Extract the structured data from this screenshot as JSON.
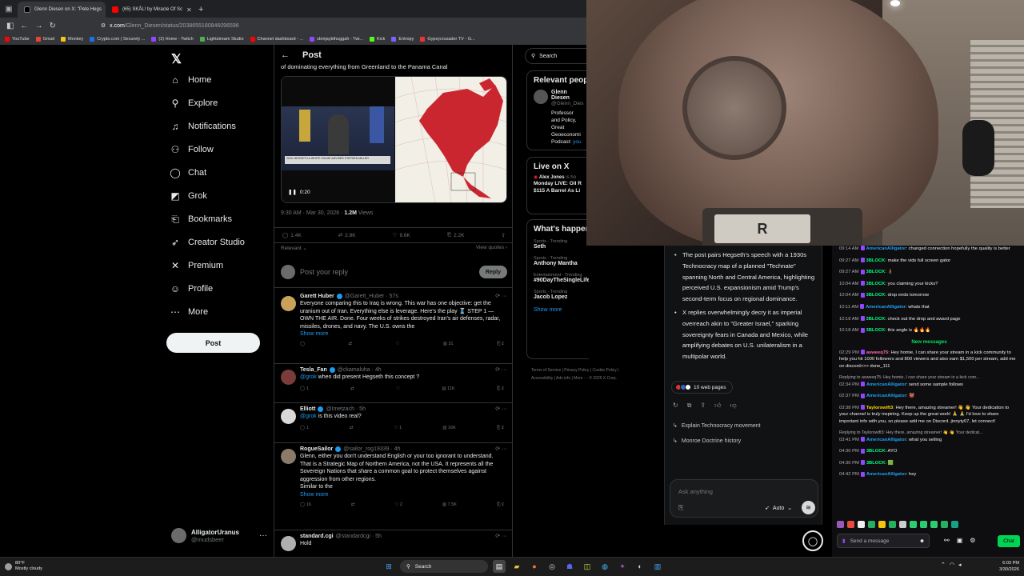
{
  "browser": {
    "tabs": [
      {
        "label": "Glenn Diesen on X: \"Pete Hegs",
        "active": true
      },
      {
        "label": "(65) SKÅL! by Miracle Of Sc",
        "active": false
      }
    ],
    "url_host": "x.com",
    "url_path": "/Glenn_Diesen/status/2038655180846096596",
    "bookmarks": [
      "YouTube",
      "Gmail",
      "Monkey",
      "Crypto.com | Securely ...",
      "(2) Home - Twitch",
      "Lightstream Studio",
      "Channel dashboard - ...",
      "sbmjaybthuggah - Twi...",
      "Kick",
      "Entropy",
      "Gypsycrusader TV - G..."
    ]
  },
  "xnav": {
    "items": [
      "Home",
      "Explore",
      "Notifications",
      "Follow",
      "Chat",
      "Grok",
      "Bookmarks",
      "Creator Studio",
      "Premium",
      "Profile",
      "More"
    ],
    "post_button": "Post",
    "account_name": "AlligatorUranus",
    "account_handle": "@mudsbeer"
  },
  "post": {
    "header": "Post",
    "text_tail": "of dominating everything from Greenland to the Panama Canal",
    "video_time": "0:20",
    "chyron": "2024: HEGSETH & WHITE HOUSE ADVISER STEPHEN MILLER",
    "timestamp": "9:30 AM · Mar 30, 2026 · ",
    "views": "1.2M",
    "views_label": "Views",
    "stats": {
      "replies": "1.4K",
      "reposts": "2.8K",
      "likes": "9.6K",
      "bookmarks": "2.2K"
    },
    "sort_label": "Relevant",
    "view_quotes": "View quotes",
    "reply_placeholder": "Post your reply",
    "reply_button": "Reply"
  },
  "replies": [
    {
      "name": "Garett Huber",
      "handle": "@Garett_Huber · 57s",
      "text": "Everyone comparing this to Iraq is wrong. This war has one objective: get the uranium out of Iran. Everything else is leverage. Here's the play 🧵 STEP 1 — OWN THE AIR. Done. Four weeks of strikes destroyed Iran's air defenses, radar, missiles, drones, and navy. The U.S. owns the",
      "more": "Show more",
      "stats": [
        "",
        "",
        "",
        "31",
        ""
      ]
    },
    {
      "name": "Tesla_Fan",
      "handle": "@ckamaluha · 4h",
      "mention": "@grok",
      "text": " when did present Hegseth this concept ?",
      "stats": [
        "1",
        "",
        "",
        "11K",
        ""
      ]
    },
    {
      "name": "Elliott",
      "handle": "@Imetzach · 5h",
      "mention": "@grok",
      "text": " is this video real?",
      "stats": [
        "1",
        "",
        "1",
        "16K",
        ""
      ]
    },
    {
      "name": "RogueSailor",
      "handle": "@sailor_rog19339 · 4h",
      "text": "Glenn, either you don't understand English or your too ignorant to understand.\nThat is a Strategic Map of Northern America, not the USA. It represents all the Sovereign Nations that share a common goal to protect themselves against aggression from other regions.\nSimilar to the",
      "more": "Show more",
      "stats": [
        "16",
        "",
        "2",
        "7.5K",
        ""
      ]
    },
    {
      "name": "standard.cgi",
      "handle": "@standardcgi · 5h",
      "text": "Hold"
    }
  ],
  "rcol": {
    "search_placeholder": "Search",
    "relevant_title": "Relevant people",
    "glenn_name": "Glenn Diesen",
    "glenn_handle": "@Glenn_Dies",
    "glenn_bio": "Professor and Policy, Great Geoeconomi Podcast: ",
    "glenn_link": "you",
    "live_title": "Live on X",
    "live_who": "Alex Jones",
    "live_status": "is ho",
    "live_text": "Monday LIVE: Oil R $115 A Barrel As Li",
    "happening_title": "What's happening",
    "trends": [
      {
        "cat": "Sports · Trending",
        "title": "Seth"
      },
      {
        "cat": "Sports · Trending",
        "title": "Anthony Mantha"
      },
      {
        "cat": "Entertainment · Trending",
        "title": "#90DayTheSingleLife"
      },
      {
        "cat": "Sports · Trending",
        "title": "Jacob Lopez"
      }
    ],
    "show_more": "Show more",
    "footer_1": "Terms of Service  |  Privacy Policy  |  Cookie Policy  |",
    "footer_2": "Accessibility  |  Ads info  |  More ···  © 2026 X Corp."
  },
  "grok": {
    "bullets": [
      "The post pairs Hegseth's speech with a 1930s Technocracy map of a planned \"Technate\" spanning North and Central America, highlighting perceived U.S. expansionism amid Trump's second-term focus on regional dominance.",
      "X replies overwhelmingly decry it as imperial overreach akin to \"Greater Israel,\" sparking sovereignty fears in Canada and Mexico, while amplifying debates on U.S. unilateralism in a multipolar world."
    ],
    "web_pages": "10 web pages",
    "suggestions": [
      "Explain Technocracy movement",
      "Monroe Doctrine history"
    ],
    "ask_placeholder": "Ask anything",
    "mode": "Auto"
  },
  "chat": {
    "messages": [
      {
        "ts": "09:14 AM",
        "user": "AmericanAlligator",
        "cls": "u1",
        "text": ": changed connection hopefully the quality is better"
      },
      {
        "ts": "09:27 AM",
        "user": "3BLOCK",
        "cls": "u2",
        "text": ": make the vids full screen gator"
      },
      {
        "ts": "09:27 AM",
        "user": "3BLOCK",
        "cls": "u2",
        "text": ": 🧎"
      },
      {
        "ts": "10:04 AM",
        "user": "3BLOCK",
        "cls": "u2",
        "text": ": you claiming your kicks?"
      },
      {
        "ts": "10:04 AM",
        "user": "3BLOCK",
        "cls": "u2",
        "text": ": drop ends tomorrow"
      },
      {
        "ts": "10:11 AM",
        "user": "AmericanAlligator",
        "cls": "u1",
        "text": ": whats that"
      },
      {
        "ts": "10:18 AM",
        "user": "3BLOCK",
        "cls": "u2",
        "text": ": check out the drop and award page"
      },
      {
        "ts": "10:18 AM",
        "user": "3BLOCK",
        "cls": "u2",
        "text": ": this angle is 🔥🔥🔥"
      }
    ],
    "new_messages": "New messages",
    "messages2": [
      {
        "ts": "02:29 PM",
        "user": "asweeq75",
        "cls": "u3",
        "text": ": Hey homie, I can share your stream in a kick community to help you hit 1000 followers and 800 viewers and also earn $1,500 per stream, add me on discord>>> done_111"
      },
      {
        "ref": "Replying to asweeq75: Hey homie, I can share your stream in a kick com...",
        "ts": "02:34 PM",
        "user": "AmericanAlligator",
        "cls": "u1",
        "text": ": send some sample follows"
      },
      {
        "ts": "02:37 PM",
        "user": "AmericanAlligator",
        "cls": "u1",
        "text": ": 👹"
      },
      {
        "ts": "03:38 PM",
        "user": "Taylorswift3",
        "cls": "u4",
        "text": ": Hey there, amazing streamer! 👋 👋 Your dedication to your channel is truly inspiring. Keep up the great work! 🙏 🙏 I'd love to share important info with you, so please add me on Discord. jinnyty07, let connect!"
      },
      {
        "ref": "Replying to Taylorswift3: Hey there, amazing streamer! 👋 👋 Your dedicat...",
        "ts": "03:41 PM",
        "user": "AmericanAlligator",
        "cls": "u1",
        "text": ": what you selling"
      },
      {
        "ts": "04:30 PM",
        "user": "3BLOCK",
        "cls": "u2",
        "text": ": AYO"
      },
      {
        "ts": "04:30 PM",
        "user": "3BLOCK",
        "cls": "u2",
        "text": ": 🟩"
      },
      {
        "ts": "04:42 PM",
        "user": "AmericanAlligator",
        "cls": "u1",
        "text": ": hey"
      }
    ],
    "input_placeholder": "Send a message",
    "chat_button": "Chat"
  },
  "taskbar": {
    "temp": "80°F",
    "weather": "Mostly cloudy",
    "search": "Search",
    "time": "6:03 PM",
    "date": "3/30/2026"
  }
}
